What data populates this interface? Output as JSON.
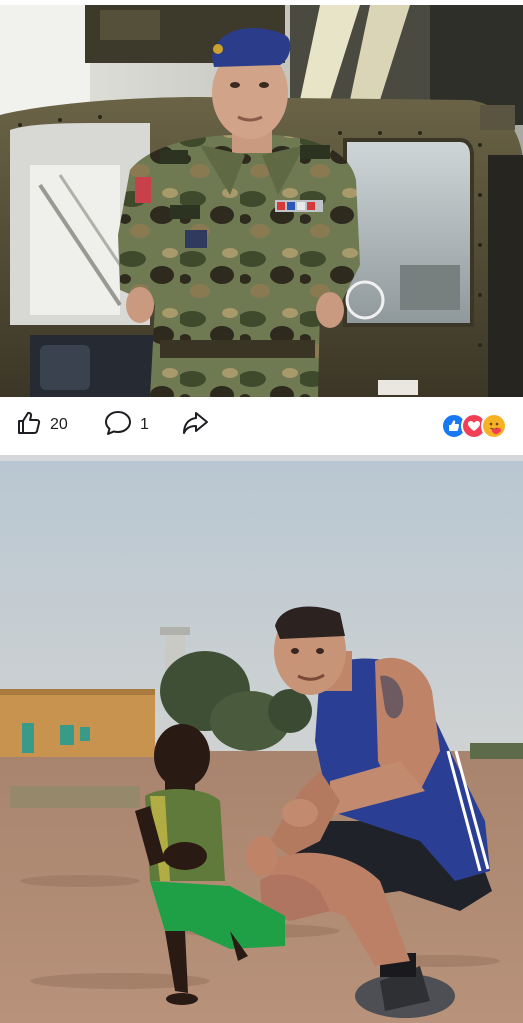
{
  "post1": {
    "photo_alt": "",
    "like_count": "20",
    "comment_count": "1",
    "reactions": [
      {
        "name": "like-reaction",
        "color": "#1877f2"
      },
      {
        "name": "love-reaction",
        "color": "#f33e58"
      },
      {
        "name": "care-reaction",
        "color": "#f7b125"
      }
    ]
  },
  "theme": {
    "icon_color": "#1c1e21",
    "divider_color": "#d6d7db"
  }
}
